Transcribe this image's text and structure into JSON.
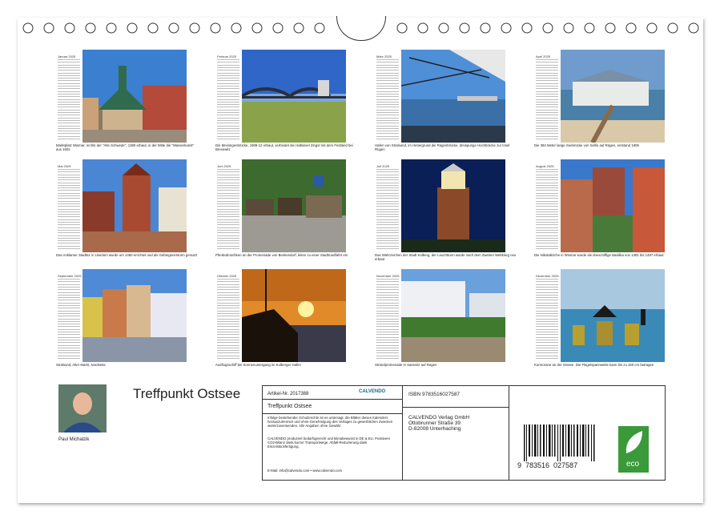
{
  "title": "Treffpunkt Ostsee",
  "author": "Paul Michalzik",
  "months": [
    {
      "name": "Januar 2025",
      "caption": "Marktplatz Wismar, rechts der \"Alte Schwede\", 1380 erbaut, in der Mitte die \"Wasserkunst\" aus 1602"
    },
    {
      "name": "Februar 2025",
      "caption": "Die Meiningenbrücke, 1908-12 erbaut, verbindet die Halbinsel Zingst mit dem Festland bei Bresewitz"
    },
    {
      "name": "März 2025",
      "caption": "Hafen von Stralsund, im Hintergrund die Rügenbrücke, dreispurige Hochbrücke zur Insel Rügen"
    },
    {
      "name": "April 2025",
      "caption": "Die 394 Meter lange Seebrücke von Sellin auf Rügen, entstand 1906"
    },
    {
      "name": "Mai 2025",
      "caption": "Das Anklamer Stadttor in Usedom wurde um 1450 errichtet und als Gefangenenturm genutzt"
    },
    {
      "name": "Juni 2025",
      "caption": "Pferdedroschken an der Promenade von Benkendorf, leiten zu einer Stadtrundfahrt ein"
    },
    {
      "name": "Juli 2025",
      "caption": "Das Wahrzeichen der Stadt Kolberg, der Leuchtturm wurde nach dem Zweiten Weltkrieg neu erbaut"
    },
    {
      "name": "August 2025",
      "caption": "Die Nikolaikirche in Wismar wurde als dreischiffige Basilika von 1381 bis 1487 erbaut"
    },
    {
      "name": "September 2025",
      "caption": "Stralsund, Alter Markt, Nordseite"
    },
    {
      "name": "Oktober 2025",
      "caption": "Ausflugsschiff bei Sonnenuntergang im Kolberger Hafen"
    },
    {
      "name": "November 2025",
      "caption": "Strandpromenade in Sassnitz auf Rügen"
    },
    {
      "name": "Dezember 2025",
      "caption": "Kormorane an der Ostsee. Die Flügelspannweite kann bis zu 160 cm betragen"
    }
  ],
  "info": {
    "article": "Artikel-Nr. 2017388",
    "brand": "CALVENDO",
    "product_title": "Treffpunkt Ostsee",
    "disclaimer": "Infolge bestehender Schutzrechte ist es untersagt, die Blätter dieses Kalenders herauszutrennen und ohne Genehmigung des Verlages zu gewerblichen Zwecken weiterzuverwenden. Alle Angaben ohne Gewähr.",
    "eco_note": "CALVENDO produziert bedarfsgerecht und klimabewusst in DE & EU. Positivere CO2-Bilanz dank kurzer Transportwege. Abfall-Reduzierung dank Einzelstückfertigung.",
    "email": "E-Mail: info@calvendo.com • www.calvendo.com",
    "isbn": "ISBN 9783516027587",
    "publisher": "CALVENDO Verlag GmbH",
    "street": "Ottobrunner Straße 39",
    "city": "D-82008 Unterhaching",
    "barcode_digits": "9  783516  027587",
    "eco_label": "eco"
  }
}
